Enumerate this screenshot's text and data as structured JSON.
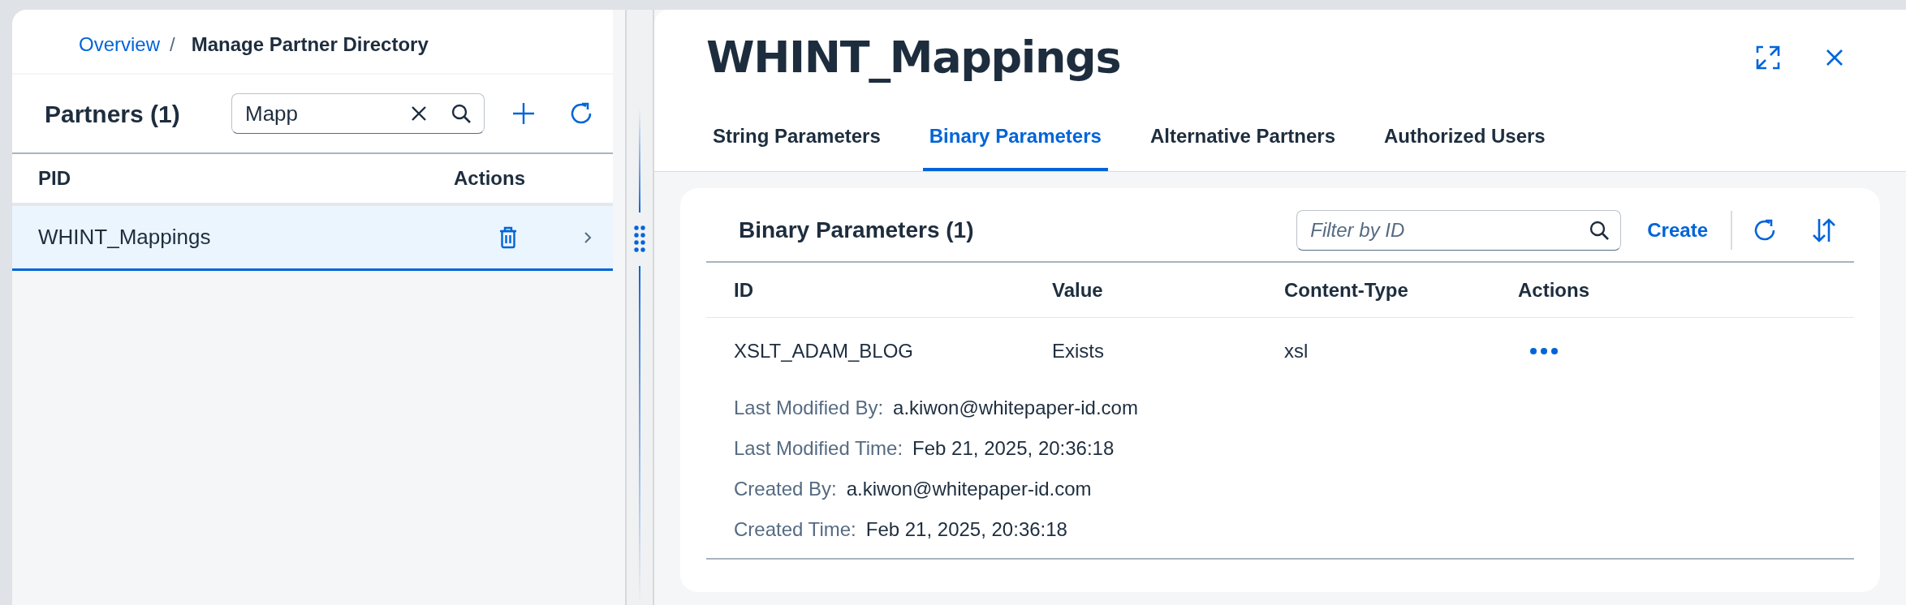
{
  "breadcrumb": {
    "link": "Overview",
    "separator": "/",
    "current": "Manage Partner Directory"
  },
  "partners": {
    "title": "Partners (1)",
    "search": {
      "value": "Mapp"
    },
    "columns": [
      "PID",
      "Actions"
    ],
    "rows": [
      {
        "pid": "WHINT_Mappings",
        "selected": true
      }
    ]
  },
  "detail": {
    "title": "WHINT_Mappings",
    "tabs": [
      {
        "label": "String Parameters",
        "selected": false
      },
      {
        "label": "Binary Parameters",
        "selected": true
      },
      {
        "label": "Alternative Partners",
        "selected": false
      },
      {
        "label": "Authorized Users",
        "selected": false
      }
    ],
    "section": {
      "title": "Binary Parameters (1)",
      "filter": {
        "placeholder": "Filter by ID"
      },
      "create_label": "Create",
      "columns": [
        "ID",
        "Value",
        "Content-Type",
        "Actions"
      ],
      "rows": [
        {
          "id": "XSLT_ADAM_BLOG",
          "value": "Exists",
          "content_type": "xsl",
          "details": [
            {
              "label": "Last Modified By:",
              "value": "a.kiwon@whitepaper-id.com"
            },
            {
              "label": "Last Modified Time:",
              "value": "Feb 21, 2025, 20:36:18"
            },
            {
              "label": "Created By:",
              "value": "a.kiwon@whitepaper-id.com"
            },
            {
              "label": "Created Time:",
              "value": "Feb 21, 2025, 20:36:18"
            }
          ]
        }
      ]
    }
  }
}
